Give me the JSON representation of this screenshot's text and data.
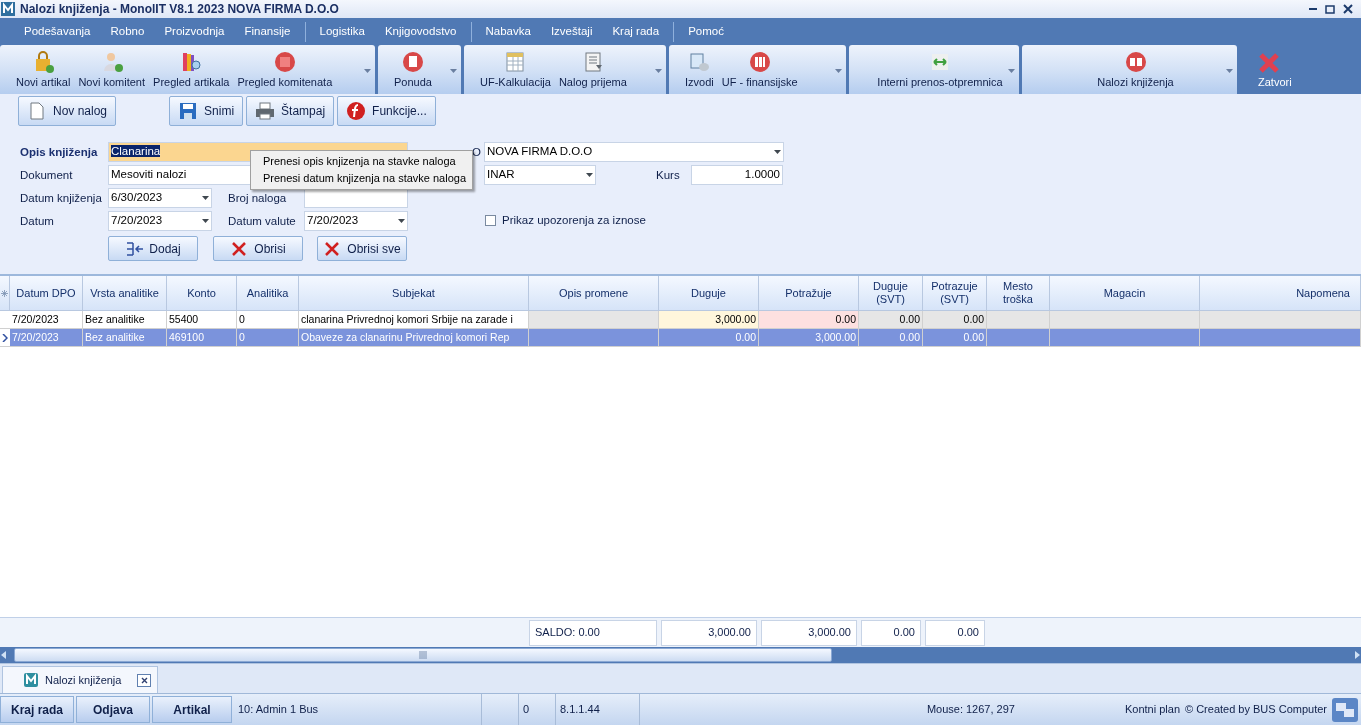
{
  "window": {
    "title": "Nalozi knjiženja - MonolIT V8.1 2023 NOVA FIRMA D.O.O"
  },
  "menu": [
    "Podešavanja",
    "Robno",
    "Proizvodnja",
    "Finansije",
    "Logistika",
    "Knjigovodstvo",
    "Nabavka",
    "Izveštaji",
    "Kraj rada",
    "Pomoć"
  ],
  "toolbar": [
    {
      "items": [
        "Novi artikal",
        "Novi komitent",
        "Pregled artikala",
        "Pregled komitenata"
      ]
    },
    {
      "items": [
        "Ponuda"
      ]
    },
    {
      "items": [
        "UF-Kalkulacija",
        "Nalog prijema"
      ]
    },
    {
      "items": [
        "Izvodi",
        "UF - finansijske"
      ]
    },
    {
      "items": [
        "Interni prenos-otpremnica"
      ]
    },
    {
      "items": [
        "Nalozi knjiženja"
      ]
    }
  ],
  "close_button": "Zatvori",
  "actions": [
    "Nov nalog",
    "Snimi",
    "Štampaj",
    "Funkcije..."
  ],
  "form": {
    "opis_label": "Opis knjiženja",
    "opis_value": "Clanarina",
    "dokument_label": "Dokument",
    "dokument_value": "Mesoviti nalozi",
    "datum_knjizenja_label": "Datum knjiženja",
    "datum_knjizenja_value": "6/30/2023",
    "datum_label": "Datum",
    "datum_value": "7/20/2023",
    "broj_naloga_label": "Broj naloga",
    "datum_valute_label": "Datum valute",
    "datum_valute_value": "7/20/2023",
    "company_label": "O",
    "company_value": "NOVA FIRMA D.O.O",
    "currency_value": "INAR",
    "kurs_label": "Kurs",
    "kurs_value": "1.0000",
    "warning_checkbox": {
      "label": "Prikaz upozorenja za iznose",
      "checked": false
    }
  },
  "context_menu": [
    "Prenesi opis knjizenja na stavke naloga",
    "Prenesi datum knjizenja na stavke naloga"
  ],
  "row_buttons": [
    "Dodaj",
    "Obrisi",
    "Obrisi sve"
  ],
  "table": {
    "columns": [
      "Datum DPO",
      "Vrsta analitike",
      "Konto",
      "Analitika",
      "Subjekat",
      "Opis promene",
      "Duguje",
      "Potražuje",
      "Duguje (SVT)",
      "Potrazuje (SVT)",
      "Mesto troška",
      "Magacin",
      "Napomena"
    ],
    "rows": [
      {
        "selected": false,
        "cells": [
          "7/20/2023",
          "Bez analitike",
          "55400",
          "0",
          "clanarina Privrednoj komori Srbije na zarade i",
          "",
          "3,000.00",
          "0.00",
          "0.00",
          "0.00",
          "",
          "",
          ""
        ]
      },
      {
        "selected": true,
        "cells": [
          "7/20/2023",
          "Bez analitike",
          "469100",
          "0",
          "Obaveze za clanarinu Privrednoj komori Rep",
          "",
          "0.00",
          "3,000.00",
          "0.00",
          "0.00",
          "",
          "",
          ""
        ]
      }
    ],
    "totals": [
      "SALDO: 0.00",
      "3,000.00",
      "3,000.00",
      "0.00",
      "0.00"
    ]
  },
  "doc_tab": {
    "label": "Nalozi knjiženja"
  },
  "status_bar": {
    "buttons": [
      "Kraj rada",
      "Odjava",
      "Artikal"
    ],
    "user": "10: Admin 1 Bus",
    "count": "0",
    "version": "8.1.1.44",
    "mouse": "Mouse: 1267, 297",
    "plan": "Kontni plan",
    "credit": "© Created by BUS Computer"
  }
}
